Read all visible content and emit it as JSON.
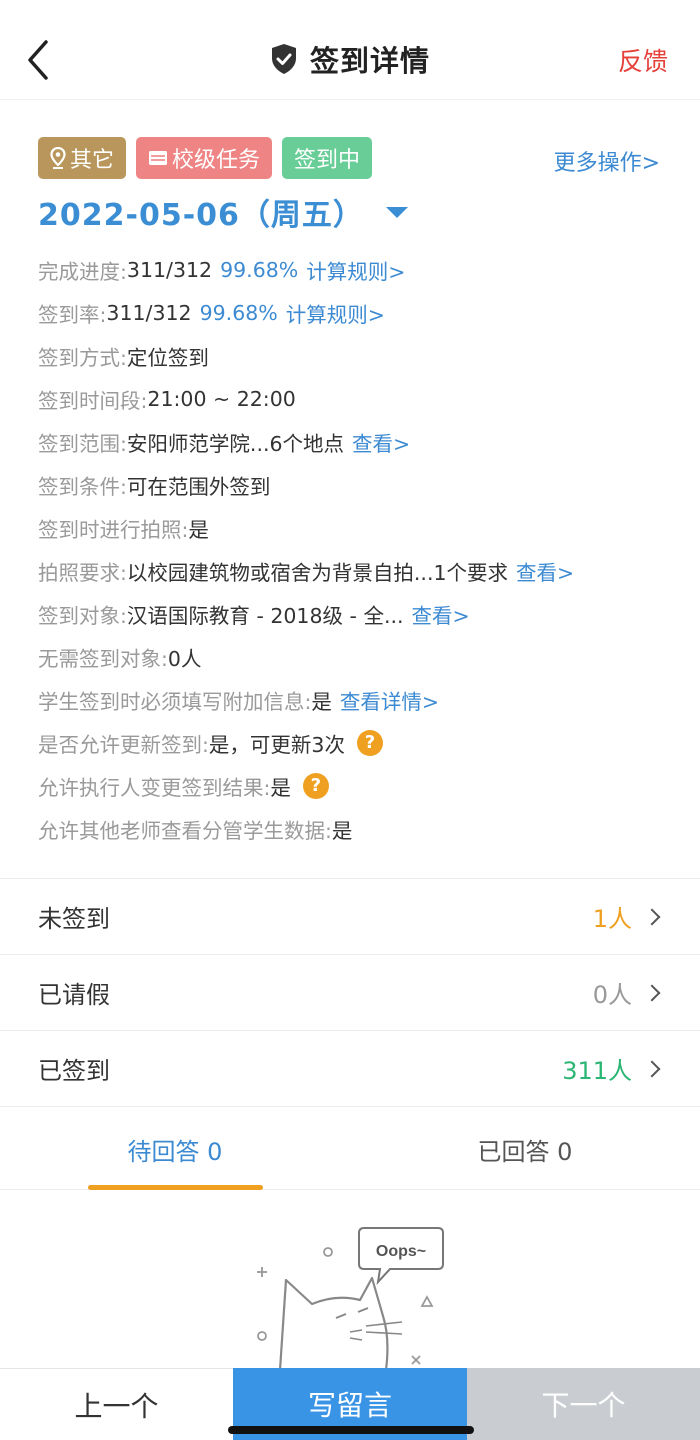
{
  "header": {
    "title": "签到详情",
    "feedback_label": "反馈"
  },
  "tags": [
    {
      "label": "其它",
      "icon": "location-pin-icon",
      "color": "#b9975c"
    },
    {
      "label": "校级任务",
      "icon": "card-icon",
      "color": "#ef8484"
    },
    {
      "label": "签到中",
      "color": "#69cd98"
    }
  ],
  "more_ops_label": "更多操作>",
  "date": "2022-05-06（周五）",
  "info": {
    "progress": {
      "label": "完成进度: ",
      "value": "311/312",
      "pct": "99.68%",
      "link": "计算规则>"
    },
    "rate": {
      "label": "签到率: ",
      "value": "311/312",
      "pct": "99.68%",
      "link": "计算规则>"
    },
    "method": {
      "label": "签到方式: ",
      "value": "定位签到"
    },
    "period": {
      "label": "签到时间段: ",
      "value": "21:00 ~ 22:00"
    },
    "range": {
      "label": "签到范围: ",
      "value": "安阳师范学院...6个地点",
      "link": "查看>"
    },
    "condition": {
      "label": "签到条件: ",
      "value": "可在范围外签到"
    },
    "photo": {
      "label": "签到时进行拍照: ",
      "value": "是"
    },
    "photo_req": {
      "label": "拍照要求: ",
      "value": "以校园建筑物或宿舍为背景自拍...1个要求",
      "link": "查看>"
    },
    "target": {
      "label": "签到对象: ",
      "value": "汉语国际教育 - 2018级 - 全...",
      "link": "查看>"
    },
    "exempt": {
      "label": "无需签到对象: ",
      "value": "0人"
    },
    "extra_info": {
      "label": "学生签到时必须填写附加信息: ",
      "value": "是",
      "link": "查看详情>"
    },
    "update": {
      "label": "是否允许更新签到: ",
      "value": "是，可更新3次",
      "help": "?"
    },
    "change_result": {
      "label": "允许执行人变更签到结果: ",
      "value": "是",
      "help": "?"
    },
    "view_data": {
      "label": "允许其他老师查看分管学生数据: ",
      "value": "是"
    }
  },
  "status": [
    {
      "label": "未签到",
      "count": "1人",
      "color": "#f0a020"
    },
    {
      "label": "已请假",
      "count": "0人",
      "color": "#999999"
    },
    {
      "label": "已签到",
      "count": "311人",
      "color": "#2bb673"
    }
  ],
  "tabs": [
    {
      "label": "待回答 0"
    },
    {
      "label": "已回答 0"
    }
  ],
  "empty_state": {
    "bubble_text": "Oops~"
  },
  "bottom_bar": {
    "prev_label": "上一个",
    "write_label": "写留言",
    "next_label": "下一个"
  }
}
